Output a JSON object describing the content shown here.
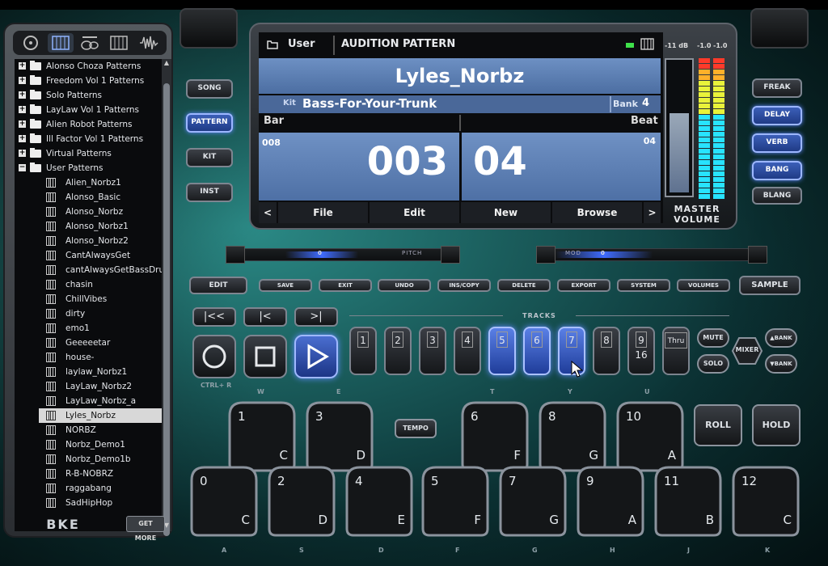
{
  "sidebar": {
    "folders": [
      {
        "label": "Alonso Choza Patterns",
        "expander": "+"
      },
      {
        "label": "Freedom Vol 1 Patterns",
        "expander": "+"
      },
      {
        "label": "Solo Patterns",
        "expander": "+"
      },
      {
        "label": "LayLaw Vol 1 Patterns",
        "expander": "+"
      },
      {
        "label": "Alien Robot Patterns",
        "expander": "+"
      },
      {
        "label": "Ill Factor Vol 1 Patterns",
        "expander": "+"
      },
      {
        "label": "Virtual Patterns",
        "expander": "+"
      },
      {
        "label": "User Patterns",
        "expander": "−"
      }
    ],
    "patterns": [
      "Alien_Norbz1",
      "Alonso_Basic",
      "Alonso_Norbz",
      "Alonso_Norbz1",
      "Alonso_Norbz2",
      "CantAlwaysGet",
      "cantAlwaysGetBassDrums",
      "chasin",
      "ChillVibes",
      "dirty",
      "emo1",
      "Geeeeetar",
      "house-",
      "laylaw_Norbz1",
      "LayLaw_Norbz2",
      "LayLaw_Norbz_a",
      "Lyles_Norbz",
      "NORBZ",
      "Norbz_Demo1",
      "Norbz_Demo1b",
      "R-B-NOBRZ",
      "raggabang",
      "SadHipHop"
    ],
    "selected_pattern": "Lyles_Norbz",
    "logo": "BKE",
    "get_more": "GET MORE"
  },
  "mode_buttons": {
    "song": "SONG",
    "pattern": "PATTERN",
    "kit": "KIT",
    "inst": "INST"
  },
  "lcd": {
    "folder": "User",
    "title": "AUDITION PATTERN",
    "pattern_name": "Lyles_Norbz",
    "kit_label": "Kit",
    "kit_name": "Bass-For-Your-Trunk",
    "bank_label": "Bank",
    "bank": "4",
    "bar_label": "Bar",
    "beat_label": "Beat",
    "bar_total": "008",
    "bar": "003",
    "beat": "04",
    "beat_total": "04",
    "softkeys": {
      "prev": "<",
      "file": "File",
      "edit": "Edit",
      "new": "New",
      "browse": "Browse",
      "next": ">"
    }
  },
  "meter": {
    "db": "-11 dB",
    "left": "-1.0",
    "right": "-1.0",
    "label_line1": "MASTER",
    "label_line2": "VOLUME",
    "volume_level": 0.6
  },
  "fx": {
    "freak": "FREAK",
    "delay": "DELAY",
    "verb": "VERB",
    "bang": "BANG",
    "blang": "BLANG"
  },
  "sliders": {
    "pitch_label": "PITCH",
    "pitch_value": "0",
    "mod_label": "MOD",
    "mod_value": "0"
  },
  "function_buttons": {
    "edit": "EDIT",
    "save": "SAVE",
    "exit": "EXIT",
    "undo": "UNDO",
    "inscopy": "INS/COPY",
    "delete": "DELETE",
    "export": "EXPORT",
    "system": "SYSTEM",
    "volumes": "VOLUMES",
    "sample": "SAMPLE"
  },
  "nav_buttons": {
    "rewind": "|<<",
    "back": "|<",
    "forward": ">|"
  },
  "tracks": {
    "label": "TRACKS",
    "items": [
      "1",
      "2",
      "3",
      "4",
      "5",
      "6",
      "7",
      "8",
      "9",
      "Thru"
    ],
    "nine_sub": "16"
  },
  "track_controls": {
    "mute": "MUTE",
    "solo": "SOLO",
    "mixer": "MIXER",
    "bank_up": "▲BANK",
    "bank_down": "▼BANK"
  },
  "transport": {
    "ctrl_label": "CTRL+ R"
  },
  "key_hints": {
    "w": "W",
    "e": "E",
    "t": "T",
    "y": "Y",
    "u": "U",
    "a": "A",
    "s": "S",
    "d": "D",
    "f": "F",
    "g": "G",
    "h": "H",
    "j": "J",
    "k": "K"
  },
  "pads": {
    "top": [
      {
        "num": "1",
        "note": "C"
      },
      {
        "num": "3",
        "note": "D"
      },
      {
        "num": "6",
        "note": "F"
      },
      {
        "num": "8",
        "note": "G"
      },
      {
        "num": "10",
        "note": "A"
      }
    ],
    "bottom": [
      {
        "num": "0",
        "note": "C"
      },
      {
        "num": "2",
        "note": "D"
      },
      {
        "num": "4",
        "note": "E"
      },
      {
        "num": "5",
        "note": "F"
      },
      {
        "num": "7",
        "note": "G"
      },
      {
        "num": "9",
        "note": "A"
      },
      {
        "num": "11",
        "note": "B"
      },
      {
        "num": "12",
        "note": "C"
      }
    ],
    "tempo": "TEMPO",
    "roll": "ROLL",
    "hold": "HOLD"
  }
}
